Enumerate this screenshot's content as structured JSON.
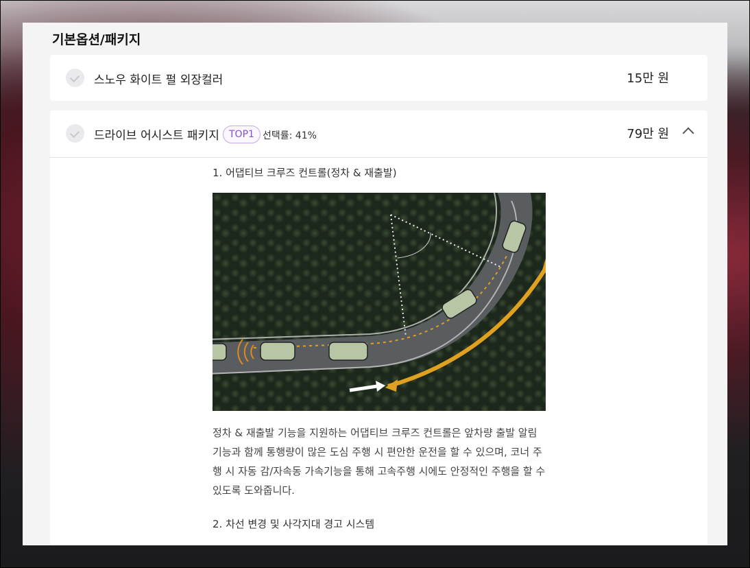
{
  "section": {
    "title": "기본옵션/패키지"
  },
  "options": [
    {
      "name": "스노우 화이트 펄 외장컬러",
      "price": "15만 원"
    },
    {
      "name": "드라이브 어시스트 패키지",
      "badge": "TOP1",
      "select_rate": "선택률: 41%",
      "price": "79만 원",
      "expanded": true,
      "features": [
        {
          "title": "1. 어댑티브 크루즈 컨트롤(정차 & 재출발)",
          "description": "정차 & 재출발 기능을 지원하는 어댑티브 크루즈 컨트롤은 앞차량 출발 알림 기능과 함께 통행량이 많은 도심 주행 시 편안한 운전을 할 수 있으며, 코너 주행 시 자동 감/자속동 가속기능을 통해 고속주행 시에도 안정적인 주행을 할 수 있도록 도와줍니다."
        },
        {
          "title": "2. 차선 변경 및 사각지대 경고 시스템"
        }
      ]
    }
  ],
  "colors": {
    "badge": "#8a4fd6",
    "accent_arrow": "#e0a020"
  }
}
